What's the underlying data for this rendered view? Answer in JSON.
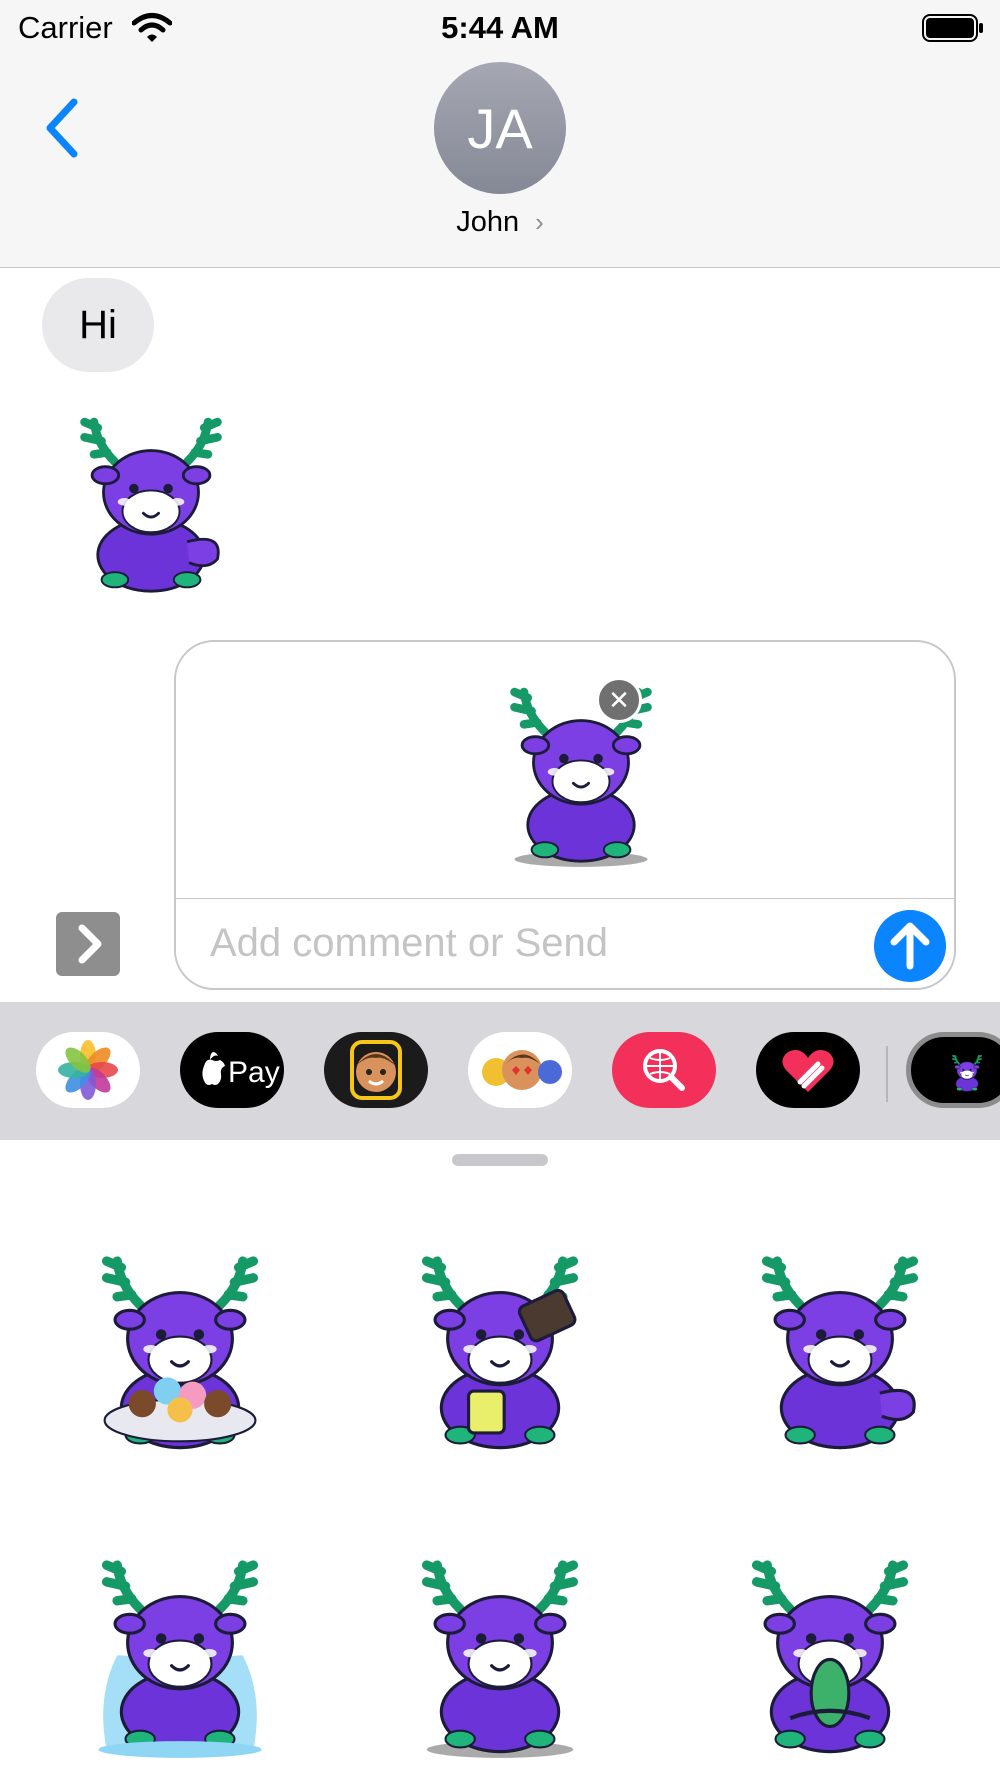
{
  "status_bar": {
    "carrier": "Carrier",
    "time": "5:44 AM"
  },
  "header": {
    "avatar_initials": "JA",
    "contact_name": "John",
    "contact_chevron": "›"
  },
  "messages": [
    {
      "type": "text",
      "from": "contact",
      "text": "Hi"
    },
    {
      "type": "sticker",
      "from": "contact",
      "sticker": "moose-thumbs-up"
    }
  ],
  "compose": {
    "attachment": "moose-sitting-sticker",
    "remove_icon": "✕",
    "placeholder": "Add comment or Send",
    "value": ""
  },
  "app_strip": {
    "apps": [
      "photos",
      "apple-pay",
      "memoji",
      "animoji",
      "image-search",
      "digital-touch",
      "moose-stickers"
    ]
  },
  "sticker_grid": [
    "moose-with-donuts",
    "moose-pouring-coffee",
    "moose-thumbs-up",
    "moose-crying",
    "moose-sitting",
    "moose-sticking-tongue-out"
  ],
  "colors": {
    "accent": "#0a84ff",
    "moose_body": "#7b3fe4",
    "antler": "#1fb47a",
    "header_bg": "#f6f6f6",
    "strip_bg": "#d8d8dc"
  }
}
